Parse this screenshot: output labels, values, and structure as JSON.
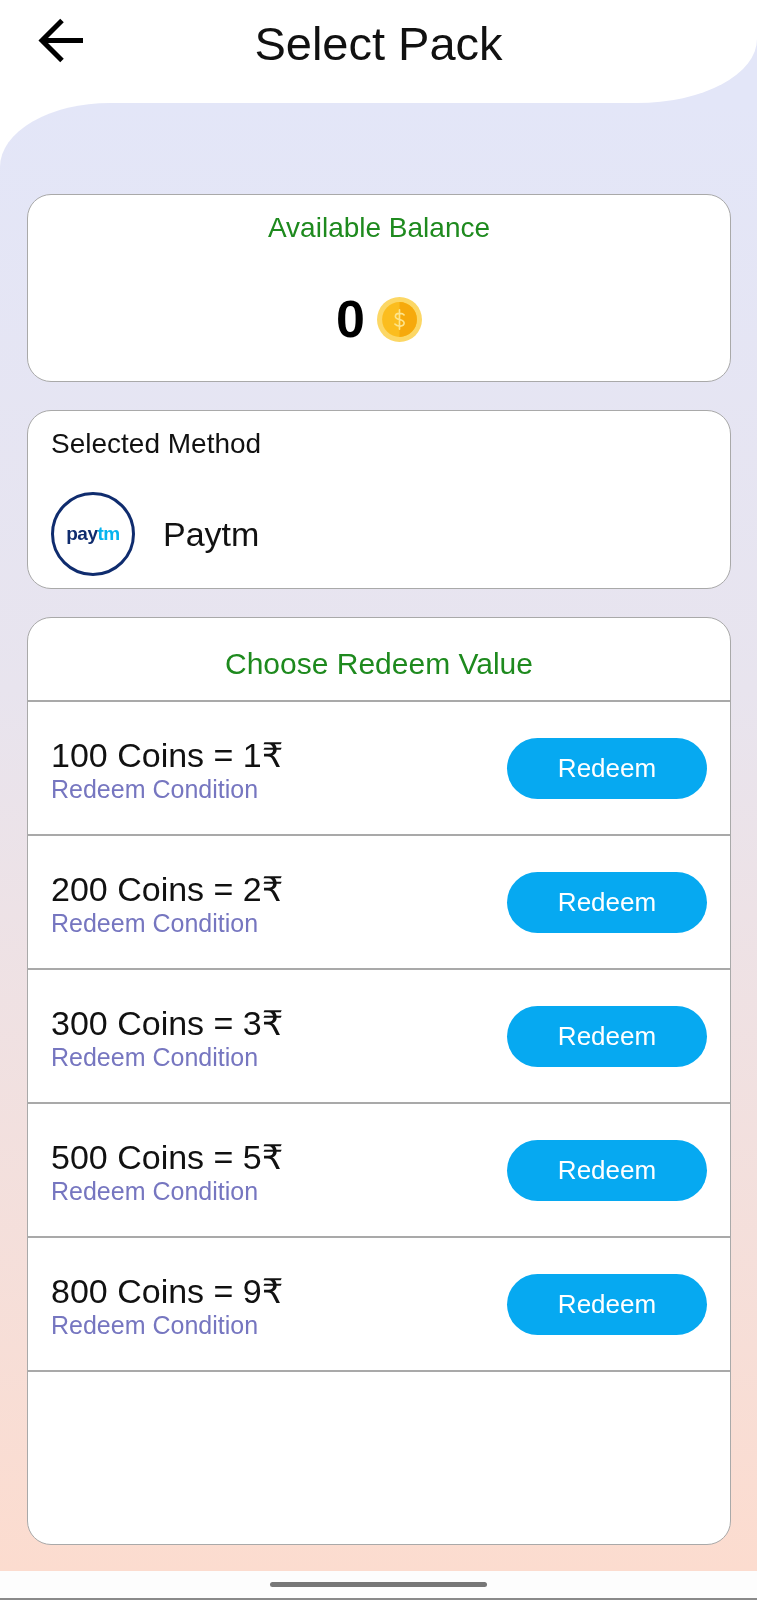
{
  "header": {
    "title": "Select Pack"
  },
  "balance": {
    "label": "Available Balance",
    "amount": "0"
  },
  "method": {
    "label": "Selected Method",
    "logo_text": [
      "pay",
      "tm"
    ],
    "name": "Paytm"
  },
  "redeem": {
    "title": "Choose Redeem Value",
    "packs": [
      {
        "value": "100 Coins = 1₹",
        "condition": "Redeem Condition",
        "button": "Redeem"
      },
      {
        "value": "200 Coins = 2₹",
        "condition": "Redeem Condition",
        "button": "Redeem"
      },
      {
        "value": "300 Coins = 3₹",
        "condition": "Redeem Condition",
        "button": "Redeem"
      },
      {
        "value": "500 Coins = 5₹",
        "condition": "Redeem Condition",
        "button": "Redeem"
      },
      {
        "value": "800 Coins = 9₹",
        "condition": "Redeem Condition",
        "button": "Redeem"
      }
    ]
  }
}
